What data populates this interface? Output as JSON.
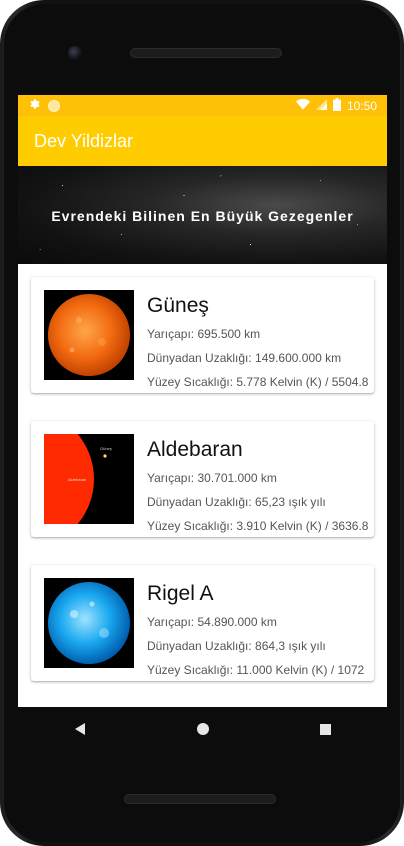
{
  "status_bar": {
    "time": "10:50"
  },
  "app_bar": {
    "title": "Dev Yildizlar"
  },
  "banner": {
    "title": "Evrendeki Bilinen En Büyük Gezegenler"
  },
  "stars": [
    {
      "name": "Güneş",
      "radius": "Yarıçapı: 695.500 km",
      "distance": "Dünyadan Uzaklığı: 149.600.000 km",
      "temperature": "Yüzey Sıcaklığı: 5.778 Kelvin (K) / 5504.8",
      "image_icon": "sun-image"
    },
    {
      "name": "Aldebaran",
      "radius": "Yarıçapı: 30.701.000 km",
      "distance": "Dünyadan Uzaklığı: 65,23 ışık yılı",
      "temperature": "Yüzey Sıcaklığı: 3.910 Kelvin (K) / 3636.8",
      "image_icon": "aldebaran-image",
      "image_labels": {
        "big": "Aldebaran",
        "small": "Güneş"
      }
    },
    {
      "name": "Rigel A",
      "radius": "Yarıçapı: 54.890.000 km",
      "distance": "Dünyadan Uzaklığı: 864,3 ışık yılı",
      "temperature": "Yüzey Sıcaklığı: 11.000 Kelvin (K) / 1072",
      "image_icon": "rigel-image"
    }
  ],
  "colors": {
    "status_bar": "#ffc107",
    "app_bar": "#ffcc00",
    "sun": "#f26a10",
    "aldebaran": "#ff2a00",
    "rigel": "#1aa8f0"
  },
  "nav": {
    "back_icon": "back-triangle-icon",
    "home_icon": "home-circle-icon",
    "recents_icon": "recents-square-icon"
  }
}
